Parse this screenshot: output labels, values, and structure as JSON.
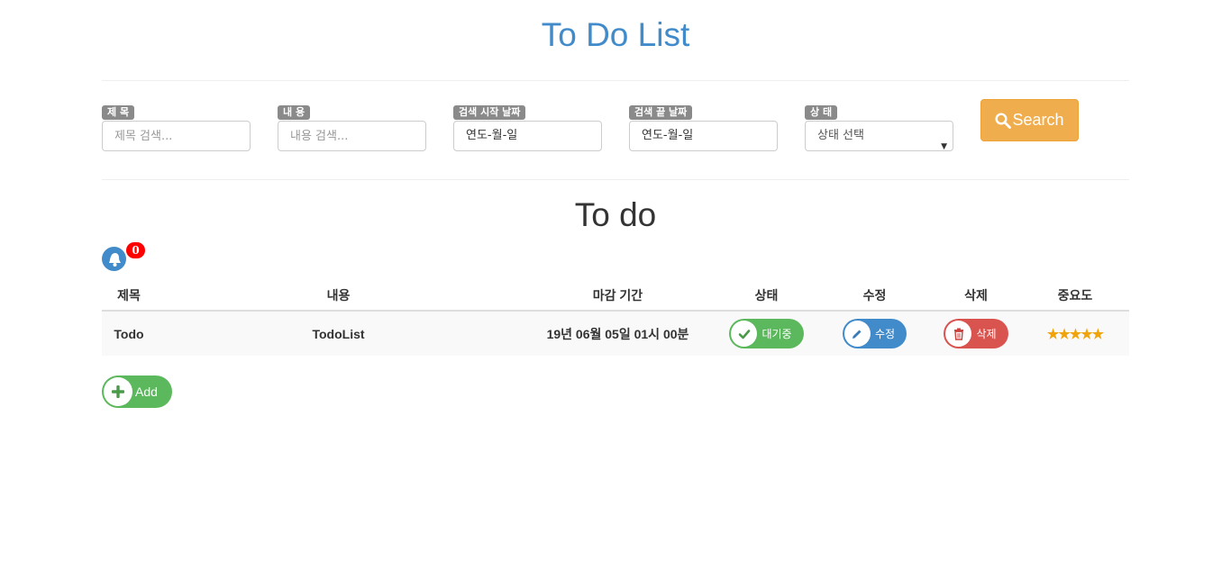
{
  "page": {
    "title": "To Do List"
  },
  "filters": {
    "title": {
      "label": "제 목",
      "placeholder": "제목 검색..."
    },
    "content": {
      "label": "내 용",
      "placeholder": "내용 검색..."
    },
    "start_date": {
      "label": "검색 시작 날짜",
      "value": "연도-월-일"
    },
    "end_date": {
      "label": "검색 끝 날짜",
      "value": "연도-월-일"
    },
    "status": {
      "label": "상 태",
      "selected": "상태 선택"
    },
    "search_label": "Search"
  },
  "section": {
    "title": "To do"
  },
  "notifications": {
    "count": "0"
  },
  "table": {
    "headers": [
      "제목",
      "내용",
      "마감 기간",
      "상태",
      "수정",
      "삭제",
      "중요도"
    ],
    "rows": [
      {
        "title": "Todo",
        "content": "TodoList",
        "deadline": "19년 06월 05일 01시 00분",
        "status": "대기중",
        "edit_label": "수정",
        "delete_label": "삭제",
        "importance": "★★★★★",
        "importance_value": 5
      }
    ]
  },
  "add_label": "Add",
  "colors": {
    "primary": "#428bca",
    "warning": "#f0ad4e",
    "success": "#5cb85c",
    "danger": "#d9534f",
    "badge": "#ff0000",
    "star": "#f0a30a"
  },
  "icons": {
    "search": "magnifier-icon",
    "notification": "bell-icon",
    "status": "check-icon",
    "edit": "pencil-icon",
    "delete": "trash-icon",
    "add": "plus-icon"
  }
}
